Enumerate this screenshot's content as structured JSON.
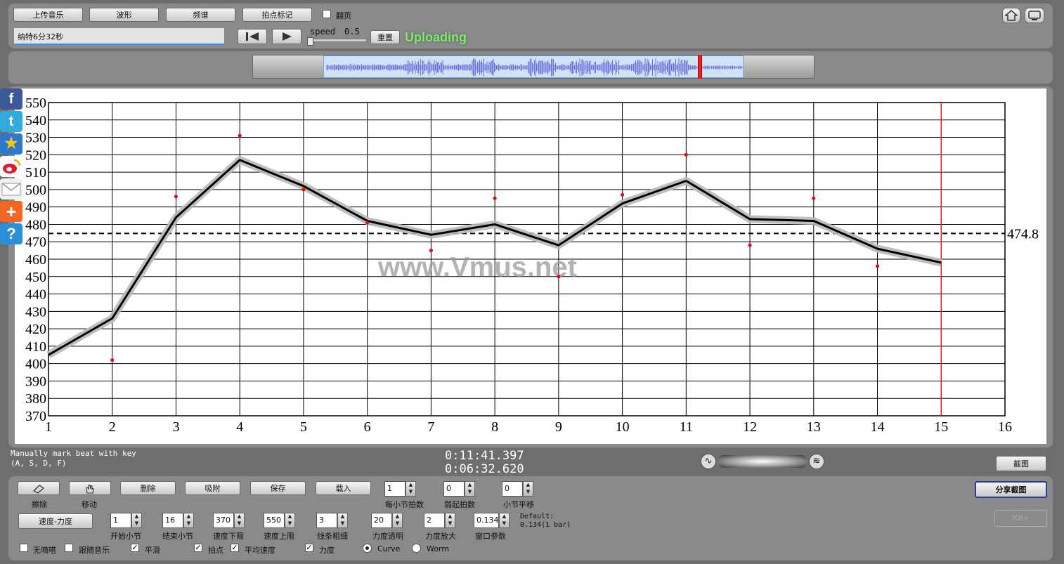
{
  "toolbar": {
    "upload_label": "上传音乐",
    "waveform_label": "波形",
    "spectrum_label": "频谱",
    "beat_mark_label": "拍点标记",
    "page_turn_label": "翻页",
    "filename": "纳特6分32秒",
    "speed_label": "speed",
    "speed_value": "0.5",
    "reset_label": "重置",
    "status": "Uploading"
  },
  "chart_data": {
    "type": "line",
    "title": "",
    "xlabel": "",
    "ylabel": "",
    "x_ticks": [
      1,
      2,
      3,
      4,
      5,
      6,
      7,
      8,
      9,
      10,
      11,
      12,
      13,
      14,
      15,
      16
    ],
    "y_ticks": [
      370,
      380,
      390,
      400,
      410,
      420,
      430,
      440,
      450,
      460,
      470,
      480,
      490,
      500,
      510,
      520,
      530,
      540,
      550
    ],
    "xlim": [
      1,
      16
    ],
    "ylim": [
      370,
      550
    ],
    "grid": true,
    "series": [
      {
        "x": [
          1,
          2,
          3,
          4,
          5,
          6,
          7,
          8,
          9,
          10,
          11,
          12,
          13,
          14,
          15
        ],
        "values": [
          405,
          426,
          484,
          517,
          502,
          482,
          474,
          480,
          468,
          492,
          505,
          483,
          482,
          466,
          458
        ]
      }
    ],
    "points": {
      "x": [
        2,
        3,
        4,
        5,
        6,
        7,
        8,
        9,
        10,
        11,
        12,
        13,
        14
      ],
      "values": [
        402,
        496,
        531,
        500,
        481,
        465,
        495,
        450,
        497,
        520,
        468,
        495,
        456
      ]
    },
    "average": 474.8,
    "average_label": "474.8",
    "cursor_x": 15,
    "watermark": "www.Vmus.net"
  },
  "info": {
    "hint_line1": "Manually mark beat with key",
    "hint_line2": "(A, S, D, F)",
    "time_total": "0:11:41.397",
    "time_current": "0:06:32.620",
    "screenshot_label": "截图"
  },
  "controls": {
    "erase_label": "擦除",
    "move_label": "移动",
    "delete_label": "删除",
    "snap_label": "吸附",
    "save_label": "保存",
    "load_label": "载入",
    "beats_per_bar_label": "每小节拍数",
    "beats_per_bar_value": "1",
    "pickup_label": "弱起拍数",
    "pickup_value": "0",
    "bar_shift_label": "小节平移",
    "bar_shift_value": "0",
    "share_label": "分享截图",
    "tempo_dynamics_label": "速度-力度",
    "start_bar_label": "开始小节",
    "start_bar_value": "1",
    "end_bar_label": "结束小节",
    "end_bar_value": "16",
    "tempo_min_label": "速度下限",
    "tempo_min_value": "370",
    "tempo_max_label": "速度上限",
    "tempo_max_value": "550",
    "line_width_label": "线条粗细",
    "line_width_value": "3",
    "dyn_alpha_label": "力度透明",
    "dyn_alpha_value": "20",
    "dyn_scale_label": "力度放大",
    "dyn_scale_value": "2",
    "window_label": "窗口参数",
    "window_value": "0.134",
    "default_line1": "Default:",
    "default_line2": "0.134(1 bar)",
    "disabled_btn": "IOI+",
    "metronome_label": "无嘀嗒",
    "follow_music_label": "跟随音乐",
    "smooth_label": "平滑",
    "beat_points_label": "拍点",
    "avg_tempo_label": "平均速度",
    "dynamics_label": "力度",
    "curve_label": "Curve",
    "worm_label": "Worm",
    "check_mark": "✓"
  },
  "social": {
    "facebook": "f",
    "twitter": "t",
    "plus": "+",
    "help": "?"
  }
}
